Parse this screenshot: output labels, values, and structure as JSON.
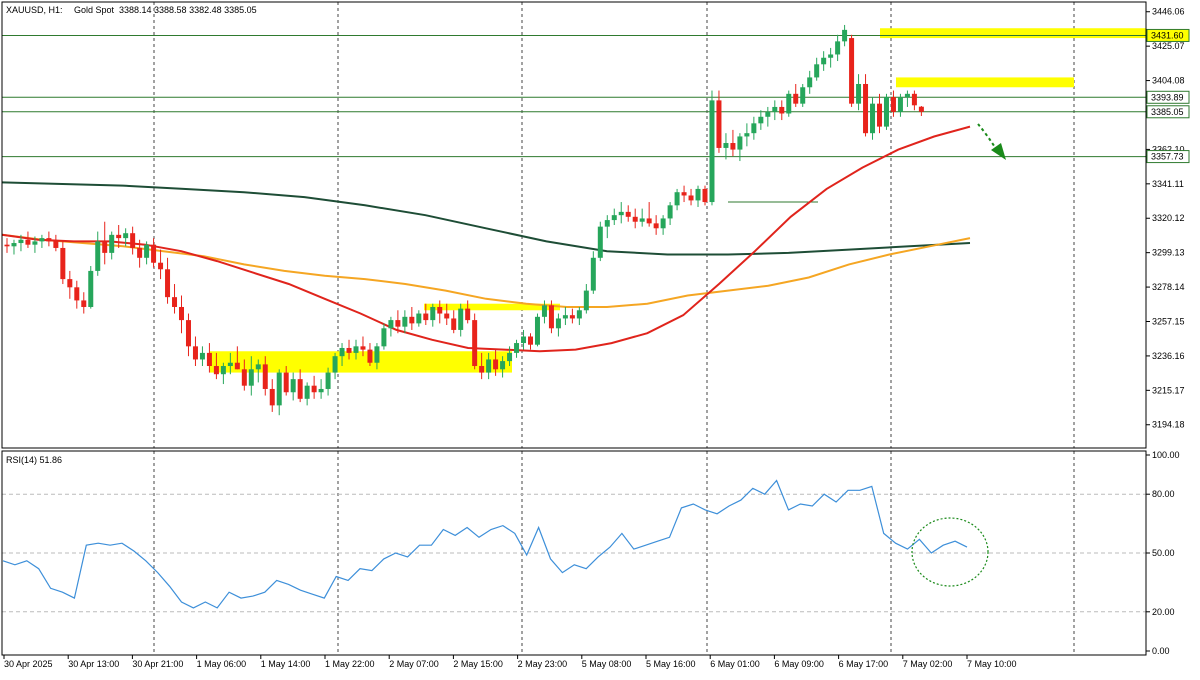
{
  "header": {
    "symbol": "XAUUSD, H1:",
    "name": "Gold Spot",
    "ohlc": "3388.14 3388.58 3382.48 3385.05"
  },
  "rsi_header": "RSI(14) 51.86",
  "price_axis": [
    "3446.06",
    "3425.07",
    "3404.08",
    "3362.10",
    "3341.11",
    "3320.12",
    "3299.13",
    "3278.14",
    "3257.15",
    "3236.16",
    "3215.17",
    "3194.18"
  ],
  "rsi_axis": [
    "100.00",
    "80.00",
    "50.00",
    "20.00",
    "0.00"
  ],
  "time_axis": [
    "30 Apr 2025",
    "30 Apr 13:00",
    "30 Apr 21:00",
    "1 May 06:00",
    "1 May 14:00",
    "1 May 22:00",
    "2 May 07:00",
    "2 May 15:00",
    "2 May 23:00",
    "5 May 08:00",
    "5 May 16:00",
    "6 May 01:00",
    "6 May 09:00",
    "6 May 17:00",
    "7 May 02:00",
    "7 May 10:00"
  ],
  "level_labels": [
    {
      "text": "3431.60",
      "color": "#ffff00"
    },
    {
      "text": "3393.89",
      "color": "#ffffff"
    },
    {
      "text": "3385.05",
      "color": "#ffffff"
    },
    {
      "text": "3357.73",
      "color": "#ffffff"
    }
  ],
  "colors": {
    "bull": "#26a65b",
    "bear": "#e8231b",
    "doji": "#d633d6",
    "ma_fast": "#e0241c",
    "ma_mid": "#f5a623",
    "ma_slow": "#1e4d36",
    "rsi": "#3d8fd9",
    "zone": "#ffff00",
    "level": "#2f7a2f",
    "arrow": "#1a8a1a",
    "grid": "#444444"
  },
  "chart_data": {
    "type": "candlestick",
    "instrument": "XAUUSD",
    "timeframe": "H1",
    "ylim": [
      3180,
      3452
    ],
    "horizontal_levels": [
      3431.6,
      3393.89,
      3385.05,
      3357.73
    ],
    "zones": [
      [
        3430,
        3436
      ],
      [
        3400,
        3406
      ],
      [
        3264,
        3268
      ],
      [
        3226,
        3239
      ]
    ],
    "candles": [
      [
        3304,
        3308,
        3299,
        3303
      ],
      [
        3303,
        3307,
        3298,
        3305
      ],
      [
        3305,
        3310,
        3300,
        3307
      ],
      [
        3307,
        3312,
        3302,
        3304
      ],
      [
        3304,
        3309,
        3299,
        3306
      ],
      [
        3306,
        3310,
        3302,
        3308
      ],
      [
        3308,
        3312,
        3303,
        3306
      ],
      [
        3306,
        3310,
        3300,
        3302
      ],
      [
        3302,
        3306,
        3280,
        3283
      ],
      [
        3283,
        3288,
        3271,
        3278
      ],
      [
        3278,
        3282,
        3265,
        3270
      ],
      [
        3270,
        3275,
        3262,
        3266
      ],
      [
        3266,
        3291,
        3265,
        3288
      ],
      [
        3288,
        3312,
        3285,
        3306
      ],
      [
        3306,
        3318,
        3292,
        3299
      ],
      [
        3299,
        3312,
        3295,
        3310
      ],
      [
        3310,
        3316,
        3302,
        3308
      ],
      [
        3308,
        3314,
        3303,
        3311
      ],
      [
        3311,
        3315,
        3298,
        3302
      ],
      [
        3302,
        3307,
        3290,
        3296
      ],
      [
        3296,
        3306,
        3292,
        3304
      ],
      [
        3304,
        3308,
        3290,
        3293
      ],
      [
        3293,
        3301,
        3283,
        3289
      ],
      [
        3289,
        3296,
        3268,
        3272
      ],
      [
        3272,
        3280,
        3262,
        3266
      ],
      [
        3266,
        3273,
        3250,
        3258
      ],
      [
        3258,
        3262,
        3236,
        3242
      ],
      [
        3242,
        3248,
        3230,
        3234
      ],
      [
        3234,
        3242,
        3230,
        3238
      ],
      [
        3238,
        3244,
        3226,
        3230
      ],
      [
        3230,
        3238,
        3222,
        3225
      ],
      [
        3225,
        3232,
        3219,
        3230
      ],
      [
        3230,
        3238,
        3225,
        3232
      ],
      [
        3232,
        3242,
        3228,
        3228
      ],
      [
        3228,
        3234,
        3215,
        3218
      ],
      [
        3218,
        3236,
        3212,
        3228
      ],
      [
        3228,
        3234,
        3220,
        3231
      ],
      [
        3231,
        3236,
        3212,
        3216
      ],
      [
        3216,
        3222,
        3202,
        3206
      ],
      [
        3206,
        3228,
        3200,
        3226
      ],
      [
        3226,
        3230,
        3212,
        3214
      ],
      [
        3214,
        3226,
        3209,
        3222
      ],
      [
        3222,
        3228,
        3208,
        3210
      ],
      [
        3210,
        3220,
        3206,
        3218
      ],
      [
        3218,
        3224,
        3210,
        3214
      ],
      [
        3214,
        3222,
        3210,
        3216
      ],
      [
        3216,
        3229,
        3212,
        3226
      ],
      [
        3226,
        3238,
        3222,
        3236
      ],
      [
        3236,
        3244,
        3230,
        3241
      ],
      [
        3241,
        3246,
        3234,
        3238
      ],
      [
        3238,
        3246,
        3234,
        3242
      ],
      [
        3242,
        3248,
        3236,
        3240
      ],
      [
        3240,
        3244,
        3230,
        3232
      ],
      [
        3232,
        3244,
        3228,
        3242
      ],
      [
        3242,
        3256,
        3240,
        3253
      ],
      [
        3253,
        3260,
        3248,
        3258
      ],
      [
        3258,
        3264,
        3250,
        3254
      ],
      [
        3254,
        3264,
        3250,
        3260
      ],
      [
        3260,
        3266,
        3252,
        3256
      ],
      [
        3256,
        3264,
        3254,
        3262
      ],
      [
        3262,
        3268,
        3255,
        3258
      ],
      [
        3258,
        3268,
        3254,
        3266
      ],
      [
        3266,
        3270,
        3256,
        3262
      ],
      [
        3262,
        3268,
        3255,
        3259
      ],
      [
        3259,
        3264,
        3250,
        3252
      ],
      [
        3252,
        3268,
        3248,
        3265
      ],
      [
        3265,
        3270,
        3256,
        3258
      ],
      [
        3258,
        3262,
        3228,
        3230
      ],
      [
        3230,
        3238,
        3222,
        3226
      ],
      [
        3226,
        3238,
        3222,
        3234
      ],
      [
        3234,
        3240,
        3224,
        3228
      ],
      [
        3228,
        3236,
        3223,
        3233
      ],
      [
        3233,
        3242,
        3230,
        3238
      ],
      [
        3238,
        3246,
        3235,
        3244
      ],
      [
        3244,
        3252,
        3240,
        3248
      ],
      [
        3248,
        3250,
        3240,
        3243
      ],
      [
        3243,
        3262,
        3242,
        3260
      ],
      [
        3260,
        3270,
        3256,
        3267
      ],
      [
        3267,
        3270,
        3250,
        3253
      ],
      [
        3253,
        3262,
        3248,
        3259
      ],
      [
        3259,
        3266,
        3255,
        3261
      ],
      [
        3261,
        3265,
        3256,
        3259
      ],
      [
        3259,
        3266,
        3255,
        3264
      ],
      [
        3264,
        3280,
        3262,
        3276
      ],
      [
        3276,
        3300,
        3274,
        3296
      ],
      [
        3296,
        3318,
        3294,
        3315
      ],
      [
        3315,
        3322,
        3308,
        3319
      ],
      [
        3319,
        3326,
        3316,
        3322
      ],
      [
        3322,
        3330,
        3317,
        3324
      ],
      [
        3324,
        3328,
        3318,
        3321
      ],
      [
        3321,
        3326,
        3314,
        3318
      ],
      [
        3318,
        3326,
        3315,
        3320
      ],
      [
        3320,
        3330,
        3315,
        3317
      ],
      [
        3317,
        3322,
        3310,
        3314
      ],
      [
        3314,
        3322,
        3310,
        3320
      ],
      [
        3320,
        3330,
        3316,
        3328
      ],
      [
        3328,
        3338,
        3325,
        3336
      ],
      [
        3336,
        3340,
        3330,
        3334
      ],
      [
        3334,
        3338,
        3328,
        3331
      ],
      [
        3331,
        3340,
        3327,
        3338
      ],
      [
        3338,
        3340,
        3328,
        3330
      ],
      [
        3330,
        3398,
        3328,
        3392
      ],
      [
        3392,
        3398,
        3360,
        3363
      ],
      [
        3363,
        3372,
        3356,
        3366
      ],
      [
        3366,
        3374,
        3358,
        3362
      ],
      [
        3362,
        3372,
        3355,
        3370
      ],
      [
        3370,
        3378,
        3364,
        3372
      ],
      [
        3372,
        3382,
        3368,
        3378
      ],
      [
        3378,
        3386,
        3374,
        3382
      ],
      [
        3382,
        3388,
        3376,
        3385
      ],
      [
        3385,
        3392,
        3380,
        3388
      ],
      [
        3388,
        3392,
        3380,
        3384
      ],
      [
        3384,
        3398,
        3382,
        3396
      ],
      [
        3396,
        3402,
        3388,
        3390
      ],
      [
        3390,
        3402,
        3388,
        3400
      ],
      [
        3400,
        3410,
        3396,
        3406
      ],
      [
        3406,
        3418,
        3404,
        3414
      ],
      [
        3414,
        3422,
        3410,
        3418
      ],
      [
        3418,
        3424,
        3412,
        3420
      ],
      [
        3420,
        3432,
        3416,
        3428
      ],
      [
        3428,
        3438,
        3425,
        3435
      ],
      [
        3430,
        3432,
        3388,
        3390
      ],
      [
        3390,
        3408,
        3386,
        3402
      ],
      [
        3402,
        3408,
        3370,
        3372
      ],
      [
        3372,
        3394,
        3368,
        3390
      ],
      [
        3390,
        3396,
        3372,
        3376
      ],
      [
        3376,
        3396,
        3374,
        3394
      ],
      [
        3394,
        3398,
        3382,
        3385
      ],
      [
        3385,
        3396,
        3382,
        3394
      ],
      [
        3394,
        3398,
        3388,
        3396
      ],
      [
        3396,
        3398,
        3386,
        3389
      ],
      [
        3388.14,
        3388.58,
        3382.48,
        3385.05
      ]
    ],
    "ma_fast": [
      3310,
      3307,
      3306,
      3306,
      3304,
      3300,
      3294,
      3287,
      3280,
      3271,
      3262,
      3252,
      3246,
      3241,
      3240,
      3239,
      3240,
      3244,
      3250,
      3261,
      3280,
      3300,
      3321,
      3338,
      3351,
      3362,
      3370,
      3376
    ],
    "ma_mid": [
      3310,
      3307,
      3305,
      3303,
      3300,
      3297,
      3292,
      3288,
      3285,
      3283,
      3280,
      3276,
      3271,
      3268,
      3266,
      3266,
      3268,
      3273,
      3276,
      3279,
      3284,
      3292,
      3298,
      3303,
      3308
    ],
    "ma_slow": [
      3342,
      3341,
      3340,
      3338,
      3336,
      3333,
      3328,
      3322,
      3314,
      3306,
      3300,
      3298,
      3298,
      3299,
      3301,
      3303,
      3305
    ],
    "rsi": [
      46,
      44,
      46,
      42,
      32,
      30,
      27,
      54,
      55,
      54,
      55,
      51,
      46,
      40,
      33,
      25,
      22,
      25,
      22,
      30,
      27,
      28,
      30,
      36,
      34,
      31,
      29,
      27,
      38,
      36,
      42,
      41,
      47,
      50,
      48,
      54,
      54,
      62,
      59,
      63,
      58,
      62,
      64,
      60,
      49,
      63,
      47,
      40,
      44,
      42,
      48,
      53,
      60,
      52,
      54,
      56,
      58,
      73,
      75,
      72,
      70,
      74,
      77,
      83,
      80,
      87,
      72,
      75,
      74,
      80,
      76,
      82,
      82,
      84,
      60,
      55,
      52,
      57,
      50,
      54,
      56,
      53
    ]
  }
}
